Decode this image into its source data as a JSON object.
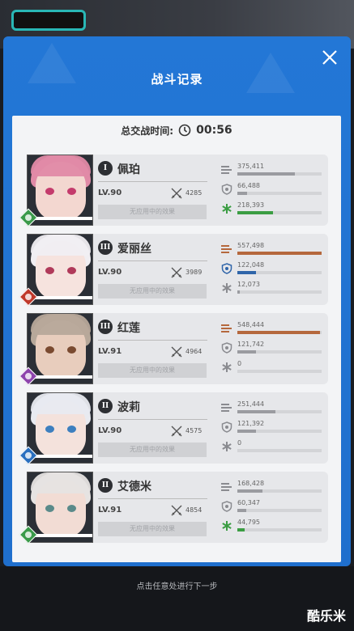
{
  "panel": {
    "title": "战斗记录",
    "total_time_label": "总交战时间:",
    "total_time_value": "00:56"
  },
  "colors": {
    "damage": "#b5683d",
    "shield": "#2f65a9",
    "heal": "#3b9d43",
    "neutral": "#9a9ba0"
  },
  "characters": [
    {
      "rank": "I",
      "name": "佩珀",
      "level": "LV.90",
      "power": "4285",
      "status": "无应用中的效果",
      "element_icon": "wind-icon",
      "element_color": "#3a9a4a",
      "portrait": {
        "hair": "#e08aa6",
        "face": "#f3d7d0",
        "eye": "#c43b6c"
      },
      "hp": 1.0,
      "stats": [
        {
          "icon": "damage-icon",
          "value": "375,411",
          "ratio": 0.68,
          "color": "#9a9ba0"
        },
        {
          "icon": "shield-icon",
          "value": "66,488",
          "ratio": 0.12,
          "color": "#9a9ba0"
        },
        {
          "icon": "heal-icon",
          "value": "218,393",
          "ratio": 0.42,
          "color": "#3b9d43"
        }
      ]
    },
    {
      "rank": "III",
      "name": "爱丽丝",
      "level": "LV.90",
      "power": "3989",
      "status": "无应用中的效果",
      "element_icon": "fire-icon",
      "element_color": "#c0392b",
      "portrait": {
        "hair": "#f0eef2",
        "face": "#f6e3de",
        "eye": "#b03a5a"
      },
      "hp": 0.35,
      "stats": [
        {
          "icon": "damage-icon",
          "value": "557,498",
          "ratio": 1.0,
          "color": "#b5683d"
        },
        {
          "icon": "shield-icon",
          "value": "122,048",
          "ratio": 0.22,
          "color": "#2f65a9"
        },
        {
          "icon": "heal-icon",
          "value": "12,073",
          "ratio": 0.03,
          "color": "#9a9ba0"
        }
      ]
    },
    {
      "rank": "III",
      "name": "红莲",
      "level": "LV.91",
      "power": "4964",
      "status": "无应用中的效果",
      "element_icon": "electric-icon",
      "element_color": "#8e44ad",
      "portrait": {
        "hair": "#b7a89a",
        "face": "#e8cdbd",
        "eye": "#7a4a30"
      },
      "hp": 0.5,
      "stats": [
        {
          "icon": "damage-icon",
          "value": "548,444",
          "ratio": 0.98,
          "color": "#b5683d"
        },
        {
          "icon": "shield-icon",
          "value": "121,742",
          "ratio": 0.22,
          "color": "#9a9ba0"
        },
        {
          "icon": "heal-icon",
          "value": "0",
          "ratio": 0.0,
          "color": "#9a9ba0"
        }
      ]
    },
    {
      "rank": "II",
      "name": "波莉",
      "level": "LV.90",
      "power": "4575",
      "status": "无应用中的效果",
      "element_icon": "water-icon",
      "element_color": "#2a6fbf",
      "portrait": {
        "hair": "#e8eaf0",
        "face": "#f4e2dc",
        "eye": "#3c7fbf"
      },
      "hp": 0.55,
      "stats": [
        {
          "icon": "damage-icon",
          "value": "251,444",
          "ratio": 0.45,
          "color": "#9a9ba0"
        },
        {
          "icon": "shield-icon",
          "value": "121,392",
          "ratio": 0.22,
          "color": "#9a9ba0"
        },
        {
          "icon": "heal-icon",
          "value": "0",
          "ratio": 0.0,
          "color": "#9a9ba0"
        }
      ]
    },
    {
      "rank": "II",
      "name": "艾德米",
      "level": "LV.91",
      "power": "4854",
      "status": "无应用中的效果",
      "element_icon": "wind-icon",
      "element_color": "#3a9a4a",
      "portrait": {
        "hair": "#e6e3e2",
        "face": "#f2dcd4",
        "eye": "#5a8a8a"
      },
      "hp": 0.5,
      "stats": [
        {
          "icon": "damage-icon",
          "value": "168,428",
          "ratio": 0.3,
          "color": "#9a9ba0"
        },
        {
          "icon": "shield-icon",
          "value": "60,347",
          "ratio": 0.11,
          "color": "#9a9ba0"
        },
        {
          "icon": "heal-icon",
          "value": "44,795",
          "ratio": 0.09,
          "color": "#3b9d43"
        }
      ]
    }
  ],
  "footer": {
    "hint": "点击任意处进行下一步",
    "watermark": "酷乐米"
  }
}
